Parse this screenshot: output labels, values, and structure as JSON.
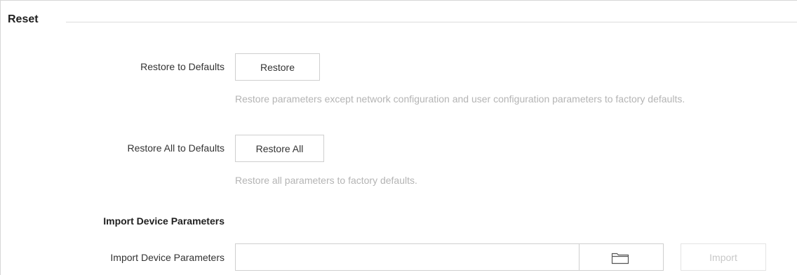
{
  "section": {
    "title": "Reset"
  },
  "restore": {
    "label": "Restore to Defaults",
    "button_label": "Restore",
    "hint": "Restore parameters except network configuration and user configuration parameters to factory defaults."
  },
  "restore_all": {
    "label": "Restore All to Defaults",
    "button_label": "Restore All",
    "hint": "Restore all parameters to factory defaults."
  },
  "import": {
    "heading": "Import Device Parameters",
    "label": "Import Device Parameters",
    "file_value": "",
    "browse_icon": "folder-icon",
    "button_label": "Import",
    "button_enabled": false
  }
}
